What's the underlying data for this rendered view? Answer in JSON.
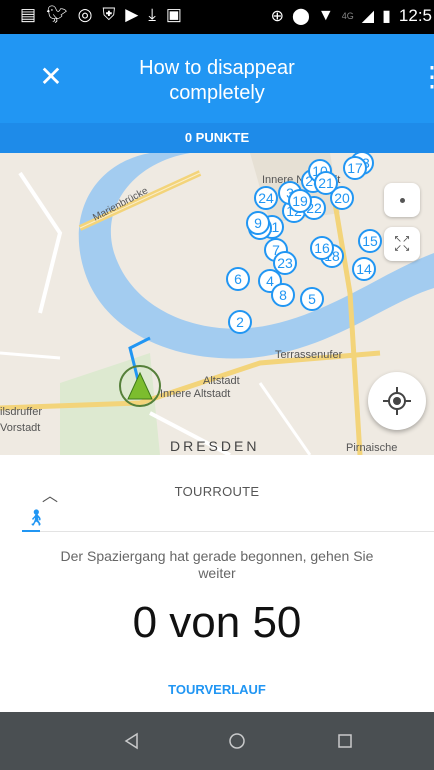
{
  "status_bar": {
    "network": "4G",
    "time": "12:5"
  },
  "appbar": {
    "title": "How to disappear completely",
    "close_icon": "close-icon",
    "menu_icon": "more-vert-icon"
  },
  "points": "0 PUNKTE",
  "map": {
    "labels": {
      "marienbrucke": "Marienbrücke",
      "innere_neustadt": "Innere Neustadt",
      "altstadt": "Altstadt",
      "innere_altstadt": "Innere Altstadt",
      "terrassenufer": "Terrassenufer",
      "wilsdruffer": "ilsdruffer",
      "vorstadt": "Vorstadt",
      "dresden": "DRESDEN",
      "pirnaische": "Pirnaische"
    },
    "markers": [
      "13",
      "25",
      "20",
      "24",
      "12",
      "22",
      "11",
      "15",
      "7",
      "18",
      "14",
      "6",
      "4",
      "8",
      "5",
      "2",
      "1",
      "3",
      "10",
      "16",
      "17",
      "19",
      "21",
      "23",
      "9"
    ],
    "colors": {
      "water": "#a3ccf0",
      "land": "#efeae2",
      "park": "#d7e8c4",
      "marker": "#2196f3",
      "road": "#f3d47a"
    }
  },
  "tour": {
    "route_title": "TOURROUTE",
    "message": "Der Spaziergang hat gerade begonnen, gehen Sie weiter",
    "counter": "0 von 50",
    "history_link": "TOURVERLAUF",
    "walk_icon": "walking-person-icon"
  },
  "navbar": {
    "back": "back-icon",
    "home": "home-icon",
    "recents": "recents-icon"
  }
}
